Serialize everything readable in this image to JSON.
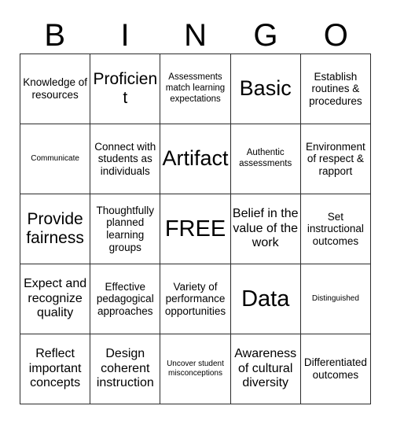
{
  "header": {
    "letters": [
      "B",
      "I",
      "N",
      "G",
      "O"
    ]
  },
  "grid": {
    "columns": 5,
    "rows": 5,
    "cells": [
      {
        "text": "Knowledge of resources",
        "size": "md"
      },
      {
        "text": "Proficient",
        "size": "xl"
      },
      {
        "text": "Assessments match learning expectations",
        "size": "sm"
      },
      {
        "text": "Basic",
        "size": "xxl"
      },
      {
        "text": "Establish routines & procedures",
        "size": "md"
      },
      {
        "text": "Communicate",
        "size": "xs"
      },
      {
        "text": "Connect with students as individuals",
        "size": "md"
      },
      {
        "text": "Artifact",
        "size": "xxl"
      },
      {
        "text": "Authentic assessments",
        "size": "sm"
      },
      {
        "text": "Environment of respect & rapport",
        "size": "md"
      },
      {
        "text": "Provide fairness",
        "size": "xl"
      },
      {
        "text": "Thoughtfully planned learning groups",
        "size": "md"
      },
      {
        "text": "FREE",
        "size": "free"
      },
      {
        "text": "Belief in the value of the work",
        "size": "lg"
      },
      {
        "text": "Set instructional outcomes",
        "size": "md"
      },
      {
        "text": "Expect and recognize quality",
        "size": "lg"
      },
      {
        "text": "Effective pedagogical approaches",
        "size": "md"
      },
      {
        "text": "Variety of performance opportunities",
        "size": "md"
      },
      {
        "text": "Data",
        "size": "free"
      },
      {
        "text": "Distinguished",
        "size": "xs"
      },
      {
        "text": "Reflect important concepts",
        "size": "lg"
      },
      {
        "text": "Design coherent instruction",
        "size": "lg"
      },
      {
        "text": "Uncover student misconceptions",
        "size": "xs"
      },
      {
        "text": "Awareness of cultural diversity",
        "size": "lg"
      },
      {
        "text": "Differentiated outcomes",
        "size": "md"
      }
    ]
  }
}
